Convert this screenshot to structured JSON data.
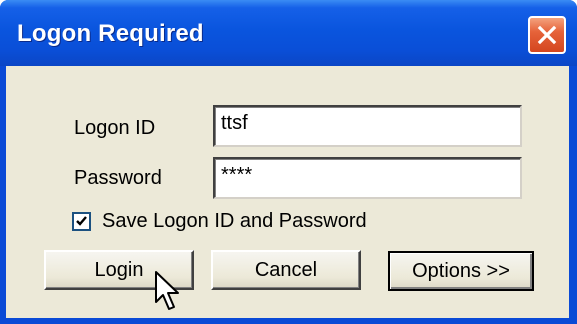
{
  "window": {
    "title": "Logon Required",
    "close_icon": "close-icon"
  },
  "form": {
    "logon_id_label": "Logon ID",
    "logon_id_value": "ttsf",
    "password_label": "Password",
    "password_value": "****",
    "save_checkbox_label": "Save Logon ID and Password",
    "save_checked": true
  },
  "buttons": {
    "login": "Login",
    "cancel": "Cancel",
    "options": "Options >>"
  },
  "colors": {
    "titlebar": "#0a55de",
    "client": "#ece9d8",
    "close_button": "#e6633a"
  },
  "pointer": "arrow-cursor-icon"
}
